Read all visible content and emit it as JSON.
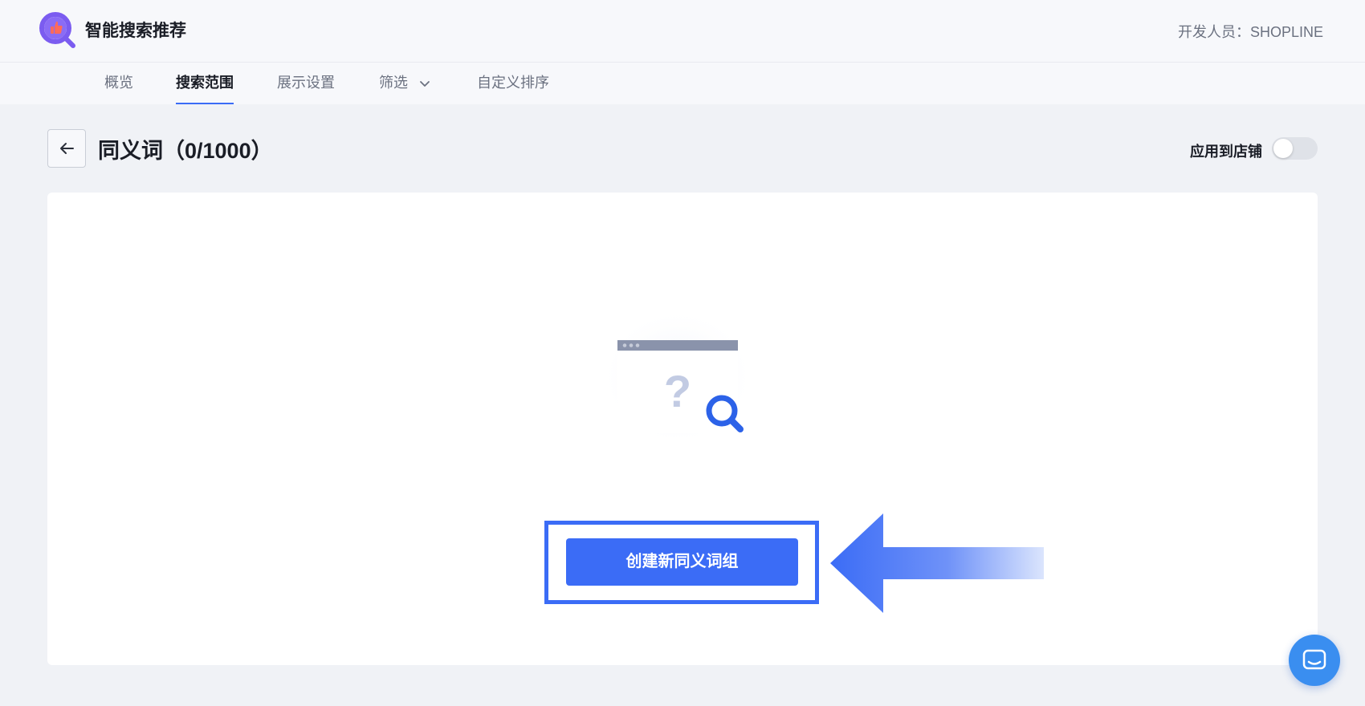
{
  "header": {
    "app_title": "智能搜索推荐",
    "developer": "开发人员：SHOPLINE"
  },
  "nav": {
    "tabs": [
      {
        "label": "概览"
      },
      {
        "label": "搜索范围"
      },
      {
        "label": "展示设置"
      },
      {
        "label": "筛选"
      },
      {
        "label": "自定义排序"
      }
    ],
    "active_tab": "搜索范围"
  },
  "page": {
    "title": "同义词（0/1000）",
    "apply_to_store_label": "应用到店铺",
    "apply_to_store_enabled": false
  },
  "empty_state": {
    "create_button_label": "创建新同义词组",
    "illustration_mark": "?"
  },
  "colors": {
    "accent": "#3b6cf6",
    "chat": "#3a8ef0",
    "background": "#f0f2f6"
  },
  "icons": {
    "logo": "search-thumbs-up-logo-icon",
    "back": "arrow-left-icon",
    "dropdown": "chevron-down-icon",
    "chat": "chat-bubble-icon"
  }
}
